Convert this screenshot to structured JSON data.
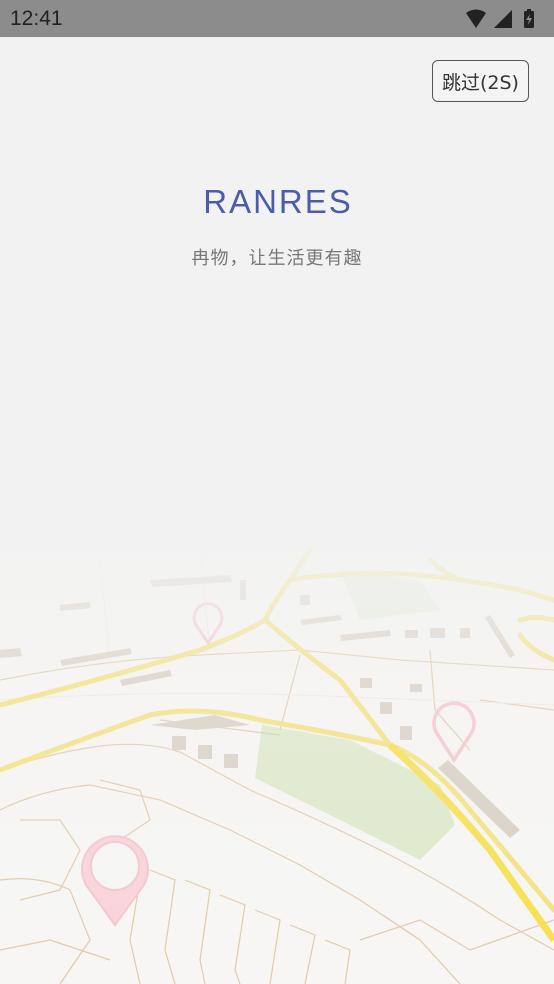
{
  "status_bar": {
    "time": "12:41",
    "icons": [
      "wifi-icon",
      "cellular-signal-icon",
      "battery-charging-icon"
    ]
  },
  "skip_button": {
    "label": "跳过(2S)"
  },
  "brand": {
    "logo_text": "RANRES",
    "logo_color": "#4a5ea8",
    "slogan": "冉物，让生活更有趣"
  },
  "colors": {
    "background": "#f2f2f2",
    "status_bar": "#8c8c8c",
    "road_main": "#f4e27a",
    "park": "#dde9c9",
    "pin": "#f7c3cc",
    "building": "#d8cfc2"
  }
}
